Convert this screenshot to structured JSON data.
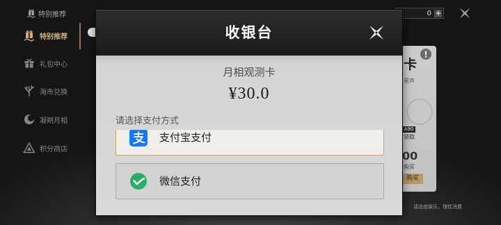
{
  "top_bar": {
    "section_title": "特别推荐",
    "currency_value": "0"
  },
  "sidebar": {
    "items": [
      {
        "label": "特别推荐",
        "icon": "gift-hand-icon",
        "active": true
      },
      {
        "label": "礼包中心",
        "icon": "gift-box-icon"
      },
      {
        "label": "海市兑换",
        "icon": "coral-exchange-icon"
      },
      {
        "label": "凝朔月相",
        "icon": "moon-phase-icon"
      },
      {
        "label": "积分商店",
        "icon": "points-store-icon"
      }
    ]
  },
  "background_card": {
    "title_fragment": "卡",
    "subtitle_fragment": "星声",
    "badge": "A90",
    "badge_label": "领取",
    "price_fragment": "00",
    "price_label": "购买",
    "buy_button": "购买"
  },
  "footer_notice": "请适度娱乐，理性消费",
  "modal": {
    "title": "收银台",
    "product_name": "月相观测卡",
    "price": "¥30.0",
    "payment_prompt": "请选择支付方式",
    "methods": [
      {
        "label": "支付宝支付",
        "icon": "alipay-icon",
        "selected": true
      },
      {
        "label": "微信支付",
        "icon": "wechat-pay-icon",
        "selected": false
      }
    ]
  },
  "colors": {
    "accent_gold": "#cfae73",
    "selected_border": "#c8a862",
    "alipay_blue": "#1677ff",
    "wechat_green": "#2aae67"
  }
}
